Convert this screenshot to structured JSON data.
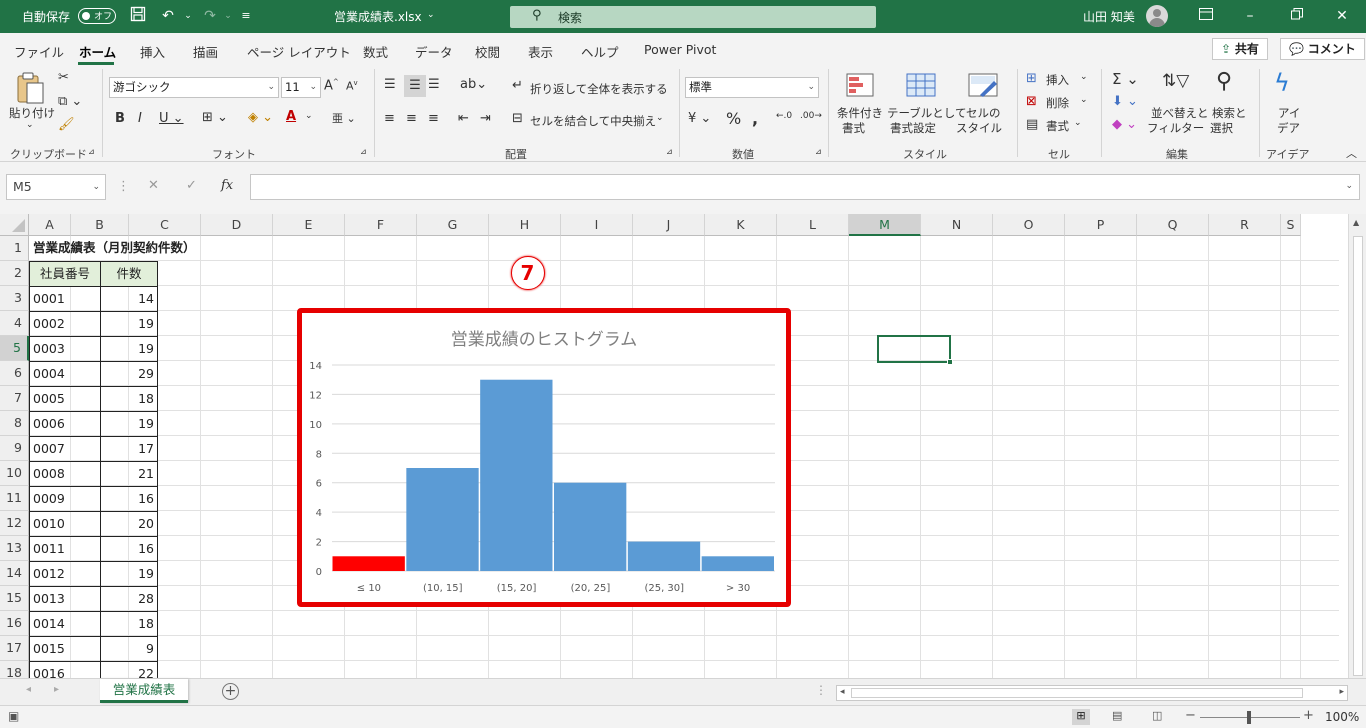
{
  "titlebar": {
    "autosave_label": "自動保存",
    "autosave_state": "オフ",
    "filename": "営業成績表.xlsx",
    "search_placeholder": "検索",
    "user_name": "山田 知美"
  },
  "tabs": [
    "ファイル",
    "ホーム",
    "挿入",
    "描画",
    "ページ レイアウト",
    "数式",
    "データ",
    "校閲",
    "表示",
    "ヘルプ",
    "Power Pivot"
  ],
  "active_tab": "ホーム",
  "share_label": "共有",
  "comment_label": "コメント",
  "ribbon": {
    "clipboard": {
      "paste": "貼り付け",
      "group": "クリップボード"
    },
    "font": {
      "name": "游ゴシック",
      "size": "11",
      "group": "フォント"
    },
    "alignment": {
      "wrap": "折り返して全体を表示する",
      "merge": "セルを結合して中央揃え",
      "group": "配置"
    },
    "number": {
      "format": "標準",
      "group": "数値"
    },
    "styles": {
      "conditional": [
        "条件付き",
        "書式"
      ],
      "table": [
        "テーブルとして",
        "書式設定"
      ],
      "cell": [
        "セルの",
        "スタイル"
      ],
      "group": "スタイル"
    },
    "cells": {
      "insert": "挿入",
      "delete": "削除",
      "format": "書式",
      "group": "セル"
    },
    "editing": {
      "sort": [
        "並べ替えと",
        "フィルター"
      ],
      "find": [
        "検索と",
        "選択"
      ],
      "group": "編集"
    },
    "ideas": {
      "label": [
        "アイ",
        "デア"
      ],
      "group": "アイデア"
    }
  },
  "formula_bar": {
    "name_box": "M5",
    "fx": "fx",
    "content": ""
  },
  "columns": [
    "A",
    "B",
    "C",
    "D",
    "E",
    "F",
    "G",
    "H",
    "I",
    "J",
    "K",
    "L",
    "M",
    "N",
    "O",
    "P",
    "Q",
    "R",
    "S"
  ],
  "selected_column": "M",
  "rows": [
    "1",
    "2",
    "3",
    "4",
    "5",
    "6",
    "7",
    "8",
    "9",
    "10",
    "11",
    "12",
    "13",
    "14",
    "15",
    "16",
    "17",
    "18"
  ],
  "selected_row": "5",
  "sheet": {
    "title": "営業成績表（月別契約件数）",
    "headers": [
      "社員番号",
      "件数"
    ],
    "records": [
      [
        "0001",
        "14"
      ],
      [
        "0002",
        "19"
      ],
      [
        "0003",
        "19"
      ],
      [
        "0004",
        "29"
      ],
      [
        "0005",
        "18"
      ],
      [
        "0006",
        "19"
      ],
      [
        "0007",
        "17"
      ],
      [
        "0008",
        "21"
      ],
      [
        "0009",
        "16"
      ],
      [
        "0010",
        "20"
      ],
      [
        "0011",
        "16"
      ],
      [
        "0012",
        "19"
      ],
      [
        "0013",
        "28"
      ],
      [
        "0014",
        "18"
      ],
      [
        "0015",
        "9"
      ],
      [
        "0016",
        "22"
      ]
    ]
  },
  "annotation": "7",
  "chart_data": {
    "type": "bar",
    "title": "営業成績のヒストグラム",
    "categories": [
      "≤ 10",
      "(10, 15]",
      "(15, 20]",
      "(20, 25]",
      "(25, 30]",
      "> 30"
    ],
    "values": [
      1,
      7,
      13,
      6,
      2,
      1
    ],
    "yticks": [
      "0",
      "2",
      "4",
      "6",
      "8",
      "10",
      "12",
      "14"
    ],
    "ylim": [
      0,
      14
    ],
    "bar_color": "#5b9bd5",
    "highlight_color": "#ff0000",
    "highlight_index": 0,
    "grid": true
  },
  "sheet_tab": "営業成績表",
  "zoom": "100%",
  "colors": {
    "excel_green": "#217346",
    "selection": "#217346",
    "annotation_red": "#e60000"
  }
}
